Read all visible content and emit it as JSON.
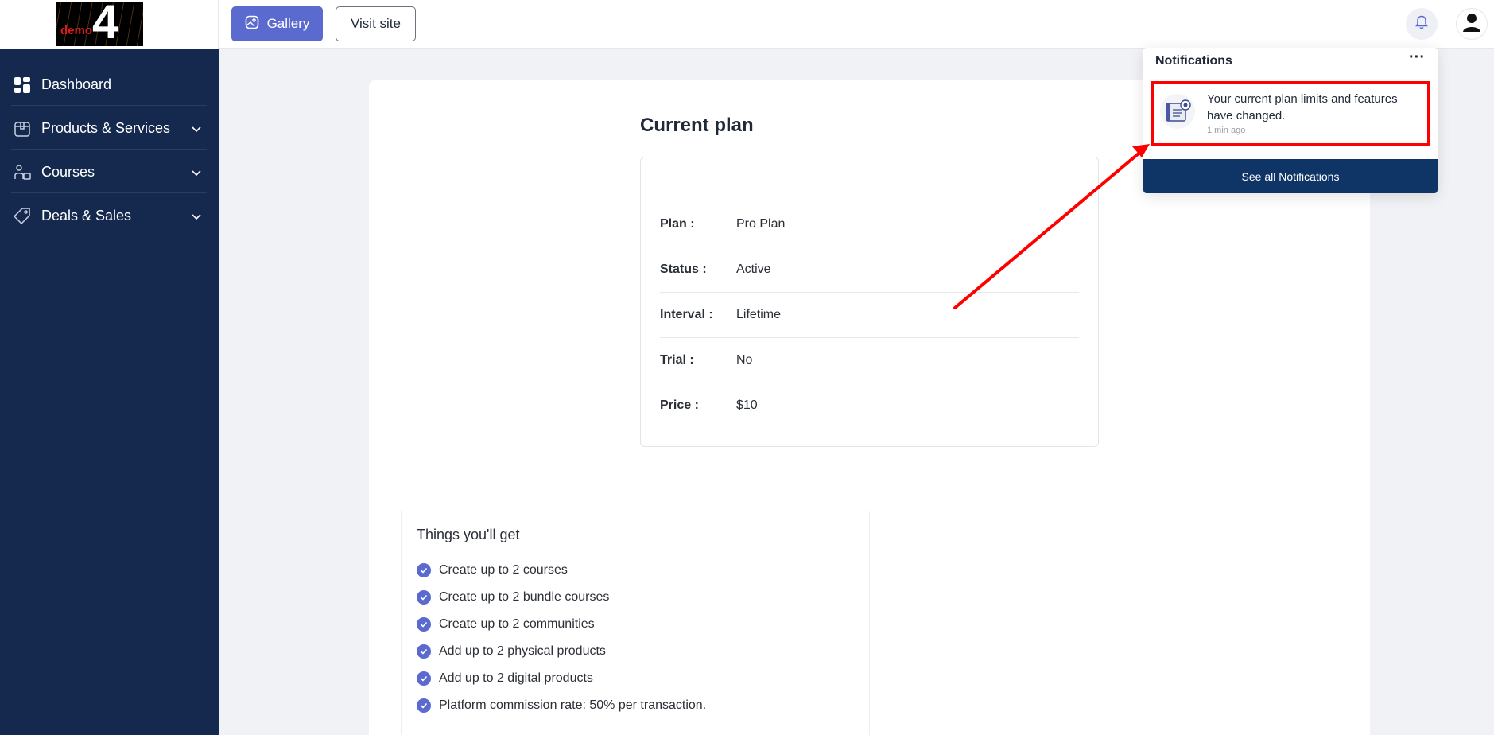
{
  "header": {
    "logo": {
      "text_small": "demo",
      "text_big": "4"
    },
    "gallery_label": "Gallery",
    "visit_label": "Visit site"
  },
  "sidebar": {
    "items": [
      {
        "label": "Dashboard",
        "icon": "dashboard-grid-icon",
        "has_chevron": false
      },
      {
        "label": "Products & Services",
        "icon": "box-icon",
        "has_chevron": true
      },
      {
        "label": "Courses",
        "icon": "courses-icon",
        "has_chevron": true
      },
      {
        "label": "Deals & Sales",
        "icon": "tag-icon",
        "has_chevron": true
      }
    ]
  },
  "main": {
    "plan_title": "Current plan",
    "plan_rows": [
      {
        "key": "Plan :",
        "value": "Pro Plan"
      },
      {
        "key": "Status :",
        "value": "Active"
      },
      {
        "key": "Interval :",
        "value": "Lifetime"
      },
      {
        "key": "Trial :",
        "value": "No"
      },
      {
        "key": "Price :",
        "value": "$10"
      }
    ],
    "features_title": "Things you'll get",
    "features": [
      "Create up to 2 courses",
      "Create up to 2 bundle courses",
      "Create up to 2 communities",
      "Add up to 2 physical products",
      "Add up to 2 digital products",
      "Platform commission rate: 50% per transaction."
    ]
  },
  "notifications": {
    "title": "Notifications",
    "more_label": "···",
    "items": [
      {
        "text": "Your current plan limits and features have changed.",
        "time": "1 min ago"
      }
    ],
    "footer_label": "See all Notifications"
  },
  "colors": {
    "sidebar_bg": "#15284e",
    "accent": "#5a6acf",
    "notif_footer_bg": "#0f3566",
    "highlight": "#ff0000"
  }
}
